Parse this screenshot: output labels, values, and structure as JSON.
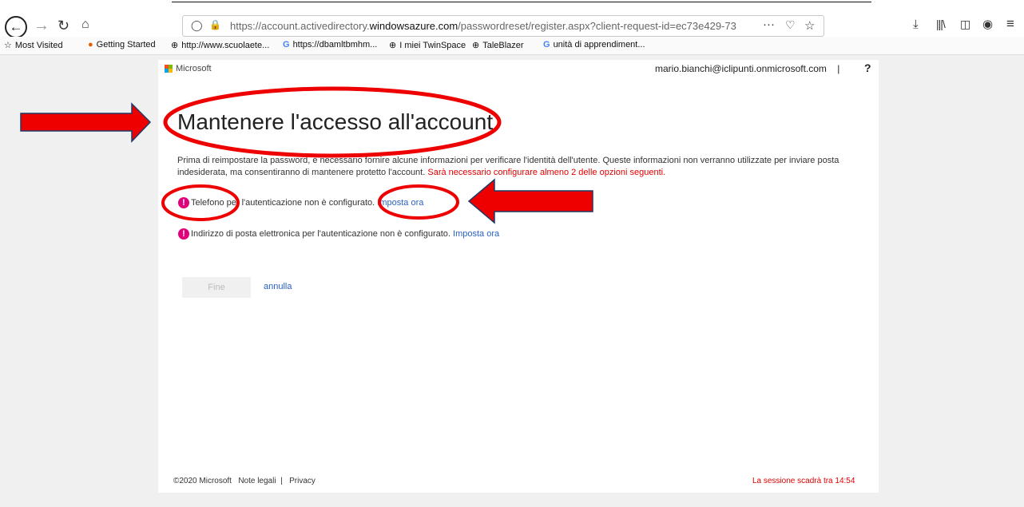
{
  "browser": {
    "url_prefix": "https://account.activedirectory.",
    "url_domain": "windowsazure.com",
    "url_path": "/passwordreset/register.aspx?client-request-id=ec73e429-73",
    "more_label": "···",
    "icons": [
      "back-icon",
      "forward-icon",
      "reload-icon",
      "home-icon",
      "shield-icon",
      "lock-icon",
      "pocket-icon",
      "star-icon",
      "download-icon",
      "library-icon",
      "sidebar-icon",
      "account-icon",
      "menu-icon"
    ]
  },
  "bookmarks": [
    {
      "label": "Most Visited",
      "icon": "☆"
    },
    {
      "label": "Getting Started",
      "icon": "●"
    },
    {
      "label": "http://www.scuolaete...",
      "icon": "⊕"
    },
    {
      "label": "https://dbamltbmhm...",
      "icon": "G"
    },
    {
      "label": "I miei TwinSpace",
      "icon": "⊕"
    },
    {
      "label": "TaleBlazer",
      "icon": "⊕"
    },
    {
      "label": "unità di apprendiment...",
      "icon": "G"
    }
  ],
  "header": {
    "brand": "Microsoft",
    "user": "mario.bianchi@iclipunti.onmicrosoft.com",
    "separator": "|",
    "help": "?"
  },
  "main": {
    "title": "Mantenere l'accesso all'account",
    "description": "Prima di reimpostare la password, è necessario fornire alcune informazioni per verificare l'identità dell'utente. Queste informazioni non verranno utilizzate per inviare posta indesiderata, ma consentiranno di mantenere protetto l'account.",
    "description_warning": "Sarà necessario configurare almeno 2 delle opzioni seguenti.",
    "options": [
      {
        "text": "Telefono per l'autenticazione non è configurato.",
        "link": "Imposta ora"
      },
      {
        "text": "Indirizzo di posta elettronica per l'autenticazione non è configurato.",
        "link": "Imposta ora"
      }
    ],
    "finish_label": "Fine",
    "cancel_label": "annulla"
  },
  "footer": {
    "copyright": "©2020 Microsoft",
    "legal": "Note legali",
    "sep": "|",
    "privacy": "Privacy",
    "session": "La sessione scadrà tra 14:54"
  },
  "colors": {
    "annotation": "#e00000",
    "link": "#2a62c4",
    "warning_icon": "#e0007a"
  }
}
